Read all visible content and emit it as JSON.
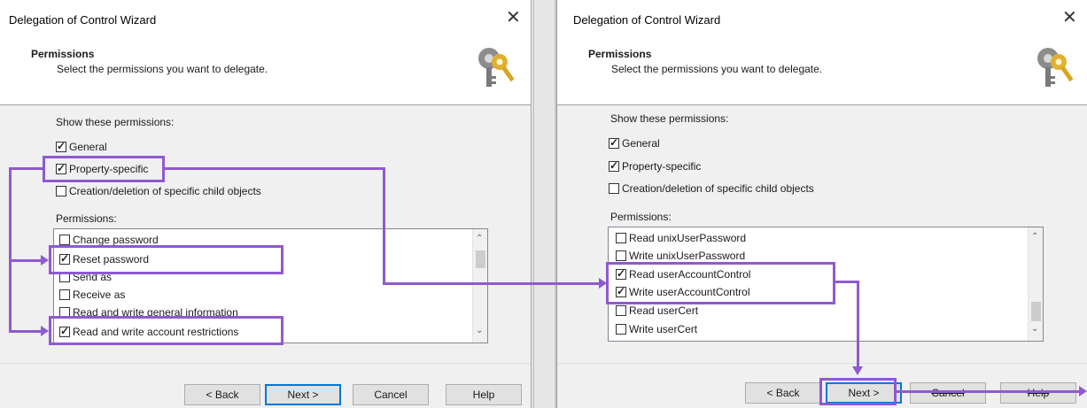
{
  "left": {
    "title": "Delegation of Control Wizard",
    "close": "✕",
    "header_title": "Permissions",
    "header_sub": "Select the permissions you want to delegate.",
    "show_label": "Show these permissions:",
    "filters": [
      {
        "label": "General",
        "checked": true
      },
      {
        "label": "Property-specific",
        "checked": true
      },
      {
        "label": "Creation/deletion of specific child objects",
        "checked": false
      }
    ],
    "permissions_label": "Permissions:",
    "permissions": [
      {
        "label": "Change password",
        "checked": false
      },
      {
        "label": "Reset password",
        "checked": true
      },
      {
        "label": "Send as",
        "checked": false
      },
      {
        "label": "Receive as",
        "checked": false
      },
      {
        "label": "Read and write general information",
        "checked": false
      },
      {
        "label": "Read and write account restrictions",
        "checked": true
      }
    ],
    "buttons": {
      "back": "< Back",
      "next": "Next >",
      "cancel": "Cancel",
      "help": "Help"
    }
  },
  "right": {
    "title": "Delegation of Control Wizard",
    "close": "✕",
    "header_title": "Permissions",
    "header_sub": "Select the permissions you want to delegate.",
    "show_label": "Show these permissions:",
    "filters": [
      {
        "label": "General",
        "checked": true
      },
      {
        "label": "Property-specific",
        "checked": true
      },
      {
        "label": "Creation/deletion of specific child objects",
        "checked": false
      }
    ],
    "permissions_label": "Permissions:",
    "permissions": [
      {
        "label": "Read unixUserPassword",
        "checked": false
      },
      {
        "label": "Write unixUserPassword",
        "checked": false
      },
      {
        "label": "Read userAccountControl",
        "checked": true
      },
      {
        "label": "Write userAccountControl",
        "checked": true
      },
      {
        "label": "Read userCert",
        "checked": false
      },
      {
        "label": "Write userCert",
        "checked": false
      }
    ],
    "buttons": {
      "back": "< Back",
      "next": "Next >",
      "cancel": "Cancel",
      "help": "Help"
    }
  },
  "icons": {
    "key": "key-icon",
    "scroll_up": "chevron-up-icon",
    "scroll_down": "chevron-down-icon"
  },
  "colors": {
    "highlight": "#8f5ad0",
    "default_button": "#0078d7"
  }
}
